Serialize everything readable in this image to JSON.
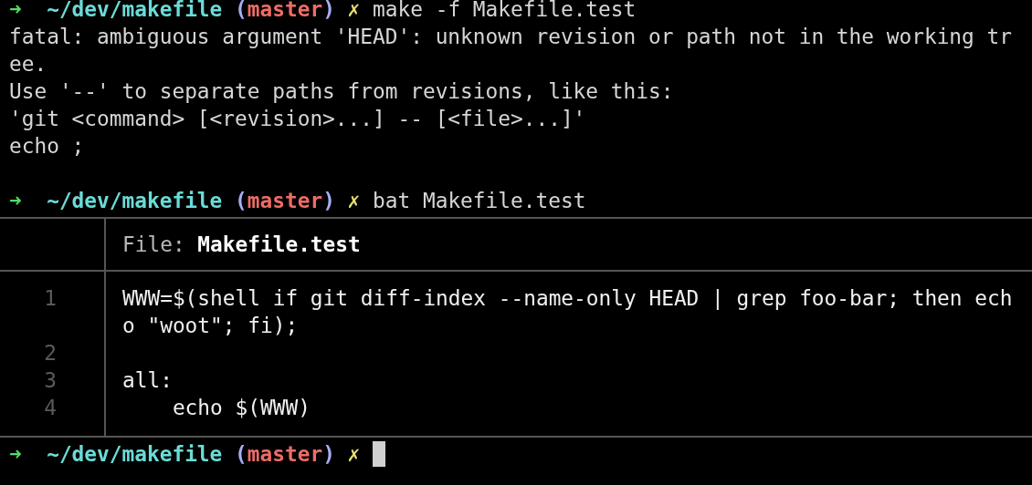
{
  "blocks": [
    {
      "kind": "prompt",
      "arrow": "➜",
      "path": "~/dev/makefile",
      "open": "(",
      "branch": "master",
      "close": ")",
      "dirty_mark": "✗",
      "command": "make -f Makefile.test",
      "cursor": false
    },
    {
      "kind": "output",
      "lines": [
        "fatal: ambiguous argument 'HEAD': unknown revision or path not in the working tr",
        "ee.",
        "Use '--' to separate paths from revisions, like this:",
        "'git <command> [<revision>...] -- [<file>...]'",
        "echo ;"
      ]
    },
    {
      "kind": "prompt",
      "arrow": "➜",
      "path": "~/dev/makefile",
      "open": "(",
      "branch": "master",
      "close": ")",
      "dirty_mark": "✗",
      "command": "bat Makefile.test",
      "cursor": false
    },
    {
      "kind": "bat",
      "header_label": "File:",
      "file_name": "Makefile.test",
      "lines": [
        {
          "number": "1",
          "text": [
            "WWW=$(shell if git diff-index --name-only HEAD | grep foo-bar; then ech",
            "o \"woot\"; fi);"
          ]
        },
        {
          "number": "2"
        },
        {
          "number": "3",
          "text": [
            "all:"
          ]
        },
        {
          "number": "4",
          "text": [
            "    echo $(WWW)"
          ]
        }
      ]
    },
    {
      "kind": "prompt",
      "arrow": "➜",
      "path": "~/dev/makefile",
      "open": "(",
      "branch": "master",
      "close": ")",
      "dirty_mark": "✗",
      "cursor": true
    }
  ]
}
